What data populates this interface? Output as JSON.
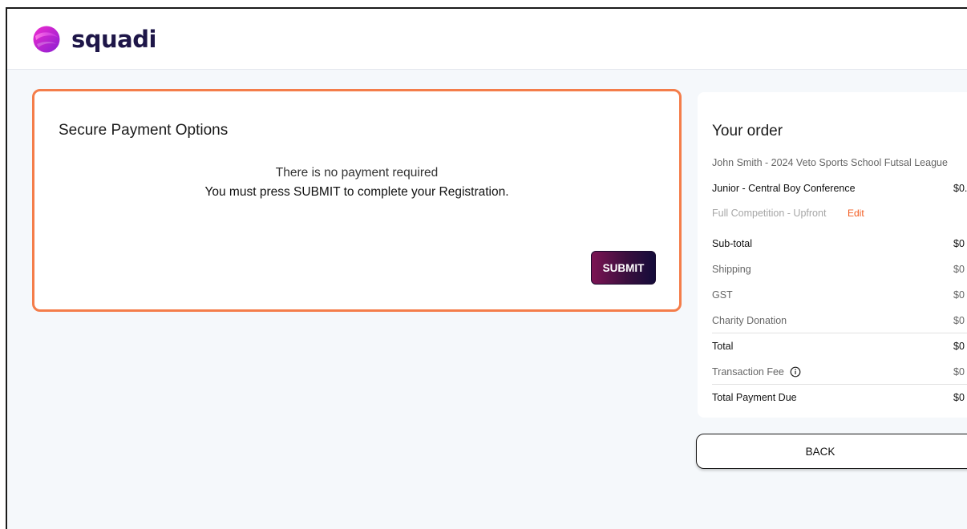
{
  "brand": {
    "name": "squadi",
    "logo_icon": "squadi-logo-icon"
  },
  "payment": {
    "title": "Secure Payment Options",
    "no_payment_text": "There is no payment required",
    "instruction_text": "You must press SUBMIT to complete your Registration.",
    "submit_label": "SUBMIT"
  },
  "order": {
    "title": "Your order",
    "registrant": "John Smith - 2024 Veto Sports School Futsal League",
    "product": {
      "label": "Junior - Central Boy Conference",
      "value": "$0."
    },
    "package": {
      "label": "Full Competition - Upfront",
      "edit_label": "Edit"
    },
    "rows": [
      {
        "label": "Sub-total",
        "value": "$0"
      },
      {
        "label": "Shipping",
        "value": "$0"
      },
      {
        "label": "GST",
        "value": "$0"
      },
      {
        "label": "Charity Donation",
        "value": "$0"
      },
      {
        "label": "Total",
        "value": "$0"
      },
      {
        "label": "Transaction Fee",
        "value": "$0",
        "icon": "info-icon"
      },
      {
        "label": "Total Payment Due",
        "value": "$0"
      }
    ]
  },
  "back_label": "BACK",
  "colors": {
    "accent_orange": "#f47d4a",
    "edit_link": "#f25a1e",
    "brand_navy": "#1e1648",
    "submit_gradient_start": "#7c1454",
    "submit_gradient_end": "#140c3a",
    "page_background": "#f5f8fb"
  }
}
